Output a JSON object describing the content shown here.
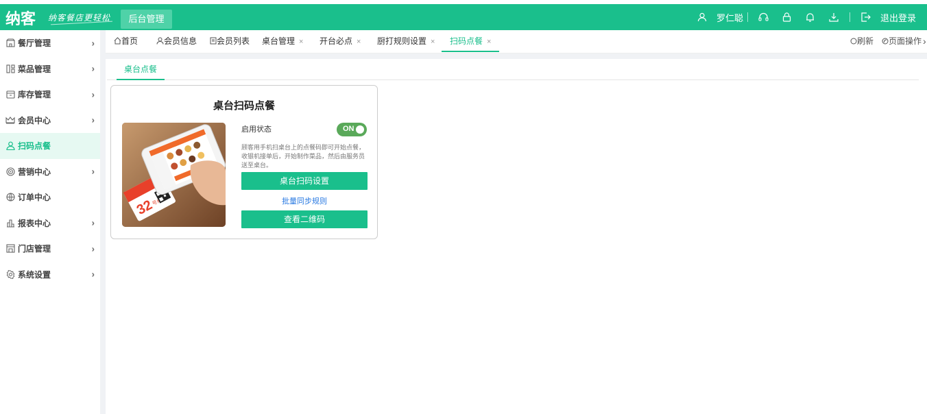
{
  "header": {
    "logo": "纳客",
    "slogan": "纳客餐店更轻松",
    "nav_active": "后台管理",
    "user": "罗仁聪",
    "logout": "退出登录",
    "icons": [
      "user-icon",
      "headset-icon",
      "lock-icon",
      "bell-icon",
      "download-icon",
      "logout-icon"
    ]
  },
  "sidebar": {
    "items": [
      {
        "label": "餐厅管理",
        "icon": "restaurant-icon",
        "arrow": "›"
      },
      {
        "label": "菜品管理",
        "icon": "dish-icon",
        "arrow": "›"
      },
      {
        "label": "库存管理",
        "icon": "inventory-icon",
        "arrow": "›"
      },
      {
        "label": "会员中心",
        "icon": "crown-icon",
        "arrow": "›"
      },
      {
        "label": "扫码点餐",
        "icon": "person-icon",
        "arrow": ""
      },
      {
        "label": "营销中心",
        "icon": "target-icon",
        "arrow": "›"
      },
      {
        "label": "订单中心",
        "icon": "globe-icon",
        "arrow": ""
      },
      {
        "label": "报表中心",
        "icon": "chart-icon",
        "arrow": "›"
      },
      {
        "label": "门店管理",
        "icon": "store-icon",
        "arrow": "›"
      },
      {
        "label": "系统设置",
        "icon": "gear-icon",
        "arrow": "›"
      }
    ],
    "active_color": "#1abf8c"
  },
  "tabs": [
    {
      "label": "首页"
    },
    {
      "label": "会员信息"
    },
    {
      "label": "会员列表"
    },
    {
      "label": "桌台管理",
      "close": "×"
    },
    {
      "label": "开台必点",
      "close": "×"
    },
    {
      "label": "厨打规则设置",
      "close": "×"
    },
    {
      "label": "扫码点餐",
      "close": "×"
    }
  ],
  "tab_tools": {
    "refresh": "刷新",
    "page_ops": "页面操作",
    "more": "›"
  },
  "subtab": "桌台点餐",
  "card": {
    "title": "桌台扫码点餐",
    "status_label": "启用状态",
    "toggle": "ON",
    "description": "顾客用手机扫桌台上的点餐码即可开始点餐，收银机接单后，开始制作菜品，然后由服务员送至桌台。",
    "primary_button": "桌台扫码设置",
    "link": "批量同步规则",
    "secondary_button": "查看二维码",
    "photo_table_number": "32",
    "photo_table_suffix": "号桌"
  },
  "colors": {
    "brand": "#1abf8c",
    "toggle_on": "#5aa95a",
    "link": "#2a7ae2"
  }
}
